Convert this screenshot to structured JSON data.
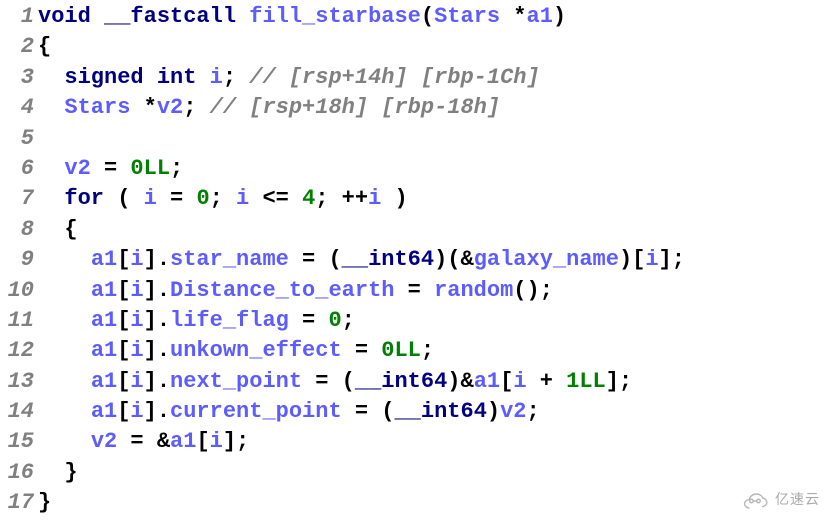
{
  "watermark": {
    "text": "亿速云"
  },
  "lines": [
    {
      "n": 1,
      "tokens": [
        [
          "kw",
          "void"
        ],
        [
          "pl",
          " "
        ],
        [
          "kw",
          "__fastcall"
        ],
        [
          "pl",
          " "
        ],
        [
          "id",
          "fill_starbase"
        ],
        [
          "pl",
          "("
        ],
        [
          "id",
          "Stars"
        ],
        [
          "pl",
          " *"
        ],
        [
          "id",
          "a1"
        ],
        [
          "pl",
          ")"
        ]
      ]
    },
    {
      "n": 2,
      "tokens": [
        [
          "pl",
          "{"
        ]
      ]
    },
    {
      "n": 3,
      "tokens": [
        [
          "pl",
          "  "
        ],
        [
          "kw",
          "signed"
        ],
        [
          "pl",
          " "
        ],
        [
          "kw",
          "int"
        ],
        [
          "pl",
          " "
        ],
        [
          "id",
          "i"
        ],
        [
          "pl",
          "; "
        ],
        [
          "cmt",
          "// [rsp+14h] [rbp-1Ch]"
        ]
      ]
    },
    {
      "n": 4,
      "tokens": [
        [
          "pl",
          "  "
        ],
        [
          "id",
          "Stars"
        ],
        [
          "pl",
          " *"
        ],
        [
          "id",
          "v2"
        ],
        [
          "pl",
          "; "
        ],
        [
          "cmt",
          "// [rsp+18h] [rbp-18h]"
        ]
      ]
    },
    {
      "n": 5,
      "tokens": []
    },
    {
      "n": 6,
      "tokens": [
        [
          "pl",
          "  "
        ],
        [
          "id",
          "v2"
        ],
        [
          "pl",
          " = "
        ],
        [
          "num",
          "0LL"
        ],
        [
          "pl",
          ";"
        ]
      ]
    },
    {
      "n": 7,
      "tokens": [
        [
          "pl",
          "  "
        ],
        [
          "kw",
          "for"
        ],
        [
          "pl",
          " ( "
        ],
        [
          "id",
          "i"
        ],
        [
          "pl",
          " = "
        ],
        [
          "num",
          "0"
        ],
        [
          "pl",
          "; "
        ],
        [
          "id",
          "i"
        ],
        [
          "pl",
          " <= "
        ],
        [
          "num",
          "4"
        ],
        [
          "pl",
          "; ++"
        ],
        [
          "id",
          "i"
        ],
        [
          "pl",
          " )"
        ]
      ]
    },
    {
      "n": 8,
      "tokens": [
        [
          "pl",
          "  {"
        ]
      ]
    },
    {
      "n": 9,
      "tokens": [
        [
          "pl",
          "    "
        ],
        [
          "id",
          "a1"
        ],
        [
          "pl",
          "["
        ],
        [
          "id",
          "i"
        ],
        [
          "pl",
          "]."
        ],
        [
          "id",
          "star_name"
        ],
        [
          "pl",
          " = ("
        ],
        [
          "kw",
          "__int64"
        ],
        [
          "pl",
          ")(&"
        ],
        [
          "id",
          "galaxy_name"
        ],
        [
          "pl",
          ")["
        ],
        [
          "id",
          "i"
        ],
        [
          "pl",
          "];"
        ]
      ]
    },
    {
      "n": 10,
      "tokens": [
        [
          "pl",
          "    "
        ],
        [
          "id",
          "a1"
        ],
        [
          "pl",
          "["
        ],
        [
          "id",
          "i"
        ],
        [
          "pl",
          "]."
        ],
        [
          "id",
          "Distance_to_earth"
        ],
        [
          "pl",
          " = "
        ],
        [
          "id",
          "random"
        ],
        [
          "pl",
          "();"
        ]
      ]
    },
    {
      "n": 11,
      "tokens": [
        [
          "pl",
          "    "
        ],
        [
          "id",
          "a1"
        ],
        [
          "pl",
          "["
        ],
        [
          "id",
          "i"
        ],
        [
          "pl",
          "]."
        ],
        [
          "id",
          "life_flag"
        ],
        [
          "pl",
          " = "
        ],
        [
          "num",
          "0"
        ],
        [
          "pl",
          ";"
        ]
      ]
    },
    {
      "n": 12,
      "tokens": [
        [
          "pl",
          "    "
        ],
        [
          "id",
          "a1"
        ],
        [
          "pl",
          "["
        ],
        [
          "id",
          "i"
        ],
        [
          "pl",
          "]."
        ],
        [
          "id",
          "unkown_effect"
        ],
        [
          "pl",
          " = "
        ],
        [
          "num",
          "0LL"
        ],
        [
          "pl",
          ";"
        ]
      ]
    },
    {
      "n": 13,
      "tokens": [
        [
          "pl",
          "    "
        ],
        [
          "id",
          "a1"
        ],
        [
          "pl",
          "["
        ],
        [
          "id",
          "i"
        ],
        [
          "pl",
          "]."
        ],
        [
          "id",
          "next_point"
        ],
        [
          "pl",
          " = ("
        ],
        [
          "kw",
          "__int64"
        ],
        [
          "pl",
          ")&"
        ],
        [
          "id",
          "a1"
        ],
        [
          "pl",
          "["
        ],
        [
          "id",
          "i"
        ],
        [
          "pl",
          " + "
        ],
        [
          "num",
          "1LL"
        ],
        [
          "pl",
          "];"
        ]
      ]
    },
    {
      "n": 14,
      "tokens": [
        [
          "pl",
          "    "
        ],
        [
          "id",
          "a1"
        ],
        [
          "pl",
          "["
        ],
        [
          "id",
          "i"
        ],
        [
          "pl",
          "]."
        ],
        [
          "id",
          "current_point"
        ],
        [
          "pl",
          " = ("
        ],
        [
          "kw",
          "__int64"
        ],
        [
          "pl",
          ")"
        ],
        [
          "id",
          "v2"
        ],
        [
          "pl",
          ";"
        ]
      ]
    },
    {
      "n": 15,
      "tokens": [
        [
          "pl",
          "    "
        ],
        [
          "id",
          "v2"
        ],
        [
          "pl",
          " = &"
        ],
        [
          "id",
          "a1"
        ],
        [
          "pl",
          "["
        ],
        [
          "id",
          "i"
        ],
        [
          "pl",
          "];"
        ]
      ]
    },
    {
      "n": 16,
      "tokens": [
        [
          "pl",
          "  }"
        ]
      ]
    },
    {
      "n": 17,
      "tokens": [
        [
          "pl",
          "}"
        ]
      ]
    }
  ]
}
